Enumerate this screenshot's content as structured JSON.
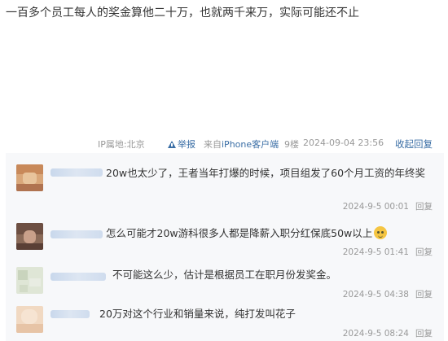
{
  "post": {
    "text": "一百多个员工每人的奖金算他二十万，也就两千来万，实际可能还不止"
  },
  "meta": {
    "ip": "IP属地:北京",
    "report": "举报",
    "device_prefix": "来自",
    "device": "iPhone客户端",
    "floor": "9楼",
    "time": "2024-09-04 23:56",
    "collapse": "收起回复"
  },
  "replies": [
    {
      "text": "20w也太少了，王者当年打爆的时候，项目组发了60个月工资的年终奖",
      "time": "2024-9-5 00:01",
      "reply_label": "回复"
    },
    {
      "text": "怎么可能才20w游科很多人都是降薪入职分红保底50w以上",
      "time": "2024-9-5 01:41",
      "reply_label": "回复",
      "emoji": "grimace-emoji"
    },
    {
      "text": "不可能这么少，估计是根据员工在职月份发奖金。",
      "time": "2024-9-5 04:38",
      "reply_label": "回复"
    },
    {
      "text": "20万对这个行业和销量来说，纯打发叫花子",
      "time": "2024-9-5 08:24",
      "reply_label": "回复"
    }
  ],
  "colors": {
    "link": "#3a6ea5",
    "muted": "#999999",
    "panel_bg": "#f7f8fa"
  }
}
